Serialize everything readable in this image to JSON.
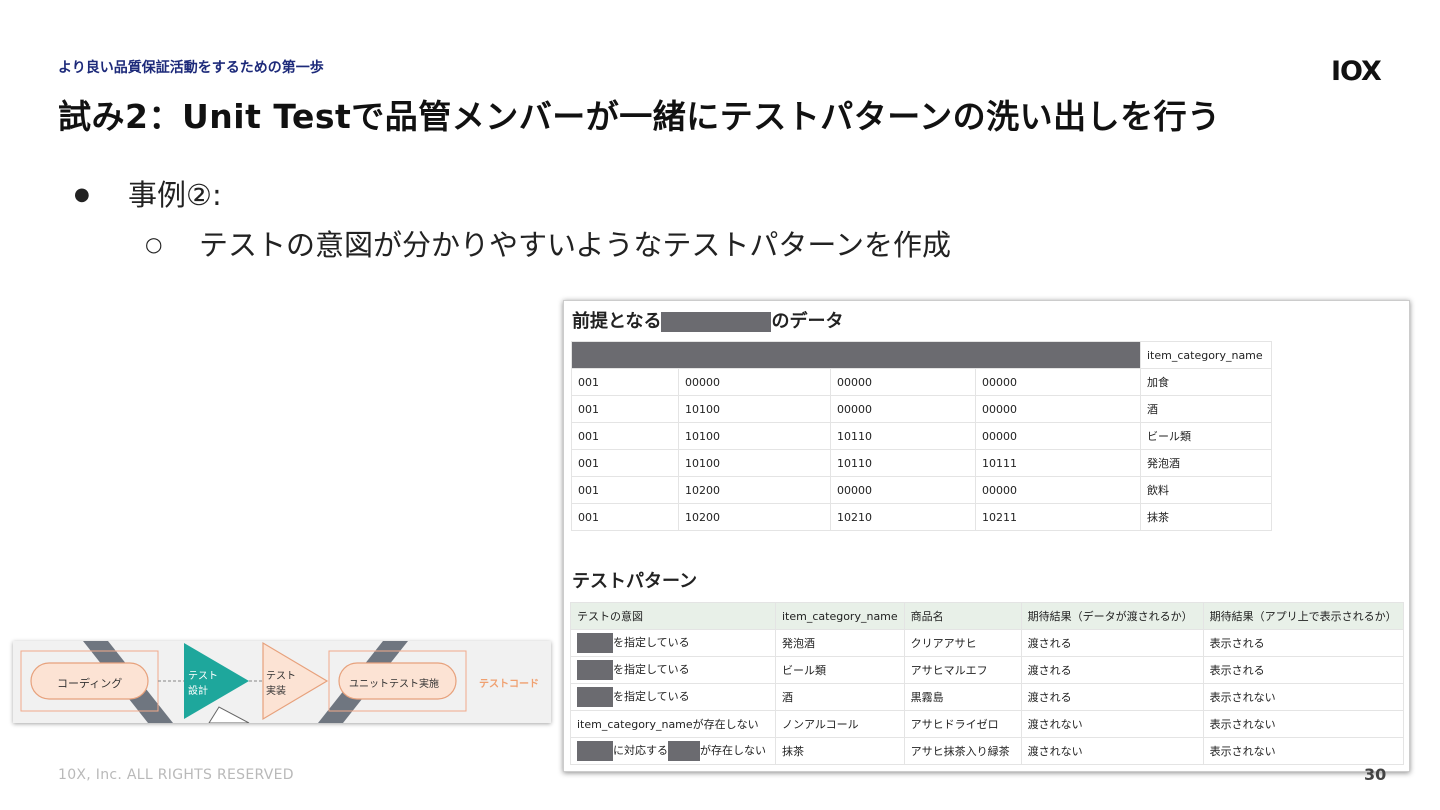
{
  "header": {
    "subtitle": "より良い品質保証活動をするための第一歩",
    "title": "試み2：Unit Testで品管メンバーが一緒にテストパターンの洗い出しを行う",
    "logo": "IOX"
  },
  "bullets": {
    "level1": "事例②:",
    "level2": "テストの意図が分かりやすいようなテストパターンを作成"
  },
  "screenshot": {
    "data_heading_pre": "前提となる",
    "data_heading_post": "のデータ",
    "data_table": {
      "header_last": "item_category_name",
      "rows": [
        [
          "001",
          "00000",
          "00000",
          "00000",
          "加食"
        ],
        [
          "001",
          "10100",
          "00000",
          "00000",
          "酒"
        ],
        [
          "001",
          "10100",
          "10110",
          "00000",
          "ビール類"
        ],
        [
          "001",
          "10100",
          "10110",
          "10111",
          "発泡酒"
        ],
        [
          "001",
          "10200",
          "00000",
          "00000",
          "飲料"
        ],
        [
          "001",
          "10200",
          "10210",
          "10211",
          "抹茶"
        ]
      ]
    },
    "pattern_heading": "テストパターン",
    "pattern_table": {
      "headers": [
        "テストの意図",
        "item_category_name",
        "商品名",
        "期待結果（データが渡されるか）",
        "期待結果（アプリ上で表示されるか）"
      ],
      "rows": [
        {
          "intent_a": "を指定している",
          "intent_b": "",
          "cat": "発泡酒",
          "name": "クリアアサヒ",
          "data": "渡される",
          "app": "表示される"
        },
        {
          "intent_a": "を指定している",
          "intent_b": "",
          "cat": "ビール類",
          "name": "アサヒマルエフ",
          "data": "渡される",
          "app": "表示される"
        },
        {
          "intent_a": "を指定している",
          "intent_b": "",
          "cat": "酒",
          "name": "黒霧島",
          "data": "渡される",
          "app": "表示されない"
        },
        {
          "intent_a": "item_category_nameが存在しない",
          "intent_b": "",
          "cat": "ノンアルコール",
          "name": "アサヒドライゼロ",
          "data": "渡されない",
          "app": "表示されない"
        },
        {
          "intent_a": "に対応する",
          "intent_b": "が存在しない",
          "cat": "抹茶",
          "name": "アサヒ抹茶入り緑茶",
          "data": "渡されない",
          "app": "表示されない"
        }
      ]
    }
  },
  "diagram": {
    "coding": "コーディング",
    "design_1": "テスト",
    "design_2": "設計",
    "impl_1": "テスト",
    "impl_2": "実装",
    "run": "ユニットテスト実施",
    "code": "テストコード"
  },
  "footer": {
    "copyright": "10X, Inc. ALL RIGHTS RESERVED",
    "page": "30"
  }
}
